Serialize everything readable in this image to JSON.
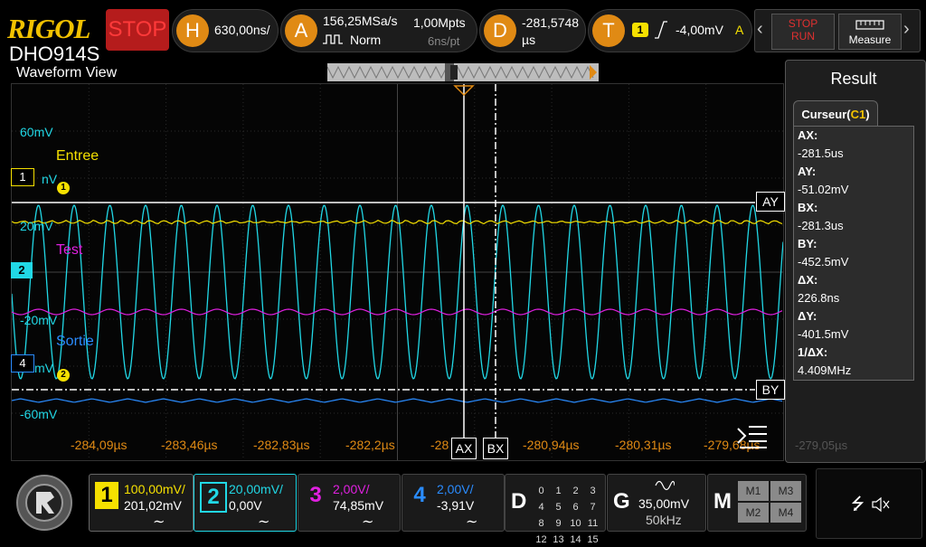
{
  "brand": "RIGOL",
  "model": "DHO914S",
  "run_state": "STOP",
  "horizontal": {
    "badge": "H",
    "timebase": "630,00ns/"
  },
  "acquire": {
    "badge": "A",
    "sample_rate": "156,25MSa/s",
    "memory": "1,00Mpts",
    "mode": "Norm",
    "resolution": "6ns/pt"
  },
  "delay": {
    "badge": "D",
    "value": "-281,5748",
    "unit": "µs"
  },
  "trigger": {
    "badge": "T",
    "source": "1",
    "level": "-4,00mV",
    "mode": "A"
  },
  "controls": {
    "stop_label": "STOP",
    "run_label": "RUN",
    "measure_label": "Measure"
  },
  "waveform_view": {
    "title": "Waveform View"
  },
  "channel_labels": {
    "ch1": "Entree",
    "ch2": "Test",
    "ch4": "Sortie"
  },
  "volt_labels": [
    "60mV",
    "nV",
    "20mV",
    "-20mV",
    "mV",
    "-60mV"
  ],
  "markers": {
    "m1": "1",
    "m2": "2",
    "m4": "4",
    "ref1": "1",
    "ref2": "2"
  },
  "cursor_labels": {
    "ay": "AY",
    "by": "BY",
    "ax": "AX",
    "bx": "BX"
  },
  "time_ticks": [
    "-284,09µs",
    "-283,46µs",
    "-282,83µs",
    "-282,2µs",
    "-28",
    "-280,94µs",
    "-280,31µs",
    "-279,68µs"
  ],
  "result": {
    "title": "Result",
    "tab_prefix": "Curseur(",
    "tab_channel": "C1",
    "tab_suffix": ")",
    "items": [
      {
        "k": "AX:",
        "v": "-281.5us"
      },
      {
        "k": "AY:",
        "v": "-51.02mV"
      },
      {
        "k": "BX:",
        "v": "-281.3us"
      },
      {
        "k": "BY:",
        "v": "-452.5mV"
      },
      {
        "k": "ΔX:",
        "v": "226.8ns"
      },
      {
        "k": "ΔY:",
        "v": "-401.5mV"
      },
      {
        "k": "1/ΔX:",
        "v": "4.409MHz"
      }
    ],
    "bottom_time": "-279,05µs"
  },
  "channels": [
    {
      "num": "1",
      "scale": "100,00mV/",
      "offset": "201,02mV",
      "coupling": "∼",
      "color": "#f5e000"
    },
    {
      "num": "2",
      "scale": "20,00mV/",
      "offset": "0,00V",
      "coupling": "∼",
      "color": "#21d8e6"
    },
    {
      "num": "3",
      "scale": "2,00V/",
      "offset": "74,85mV",
      "coupling": "∼",
      "color": "#e020e0"
    },
    {
      "num": "4",
      "scale": "2,00V/",
      "offset": "-3,91V",
      "coupling": "∼",
      "color": "#2a8cff"
    }
  ],
  "digital": {
    "label": "D",
    "rows": [
      [
        "0",
        "1",
        "2",
        "3"
      ],
      [
        "4",
        "5",
        "6",
        "7"
      ],
      [
        "8",
        "9",
        "10",
        "11"
      ],
      [
        "12",
        "13",
        "14",
        "15"
      ]
    ]
  },
  "generator": {
    "label": "G",
    "amplitude": "35,00mV",
    "frequency": "50kHz"
  },
  "math": {
    "label": "M",
    "buttons": [
      "M1",
      "M3",
      "M2",
      "M4"
    ]
  },
  "colors": {
    "ch1": "#f5e000",
    "ch2": "#21d8e6",
    "ch3": "#e020e0",
    "ch4": "#2a8cff",
    "accent": "#e08a14",
    "stop": "#b51c1c"
  }
}
